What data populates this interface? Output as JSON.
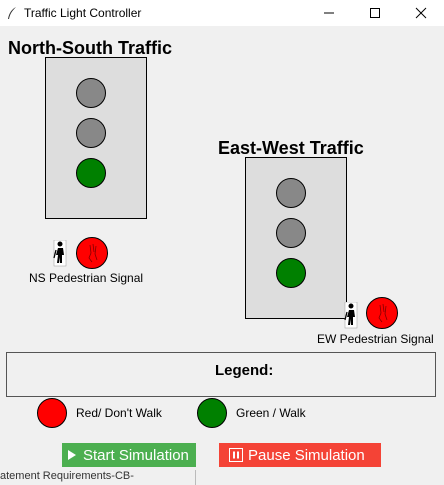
{
  "window": {
    "title": "Traffic Light Controller",
    "icon": "feather-icon",
    "controls": [
      "minimize-icon",
      "maximize-icon",
      "close-icon"
    ]
  },
  "north_south": {
    "heading": "North-South Traffic",
    "lights": [
      {
        "name": "red",
        "color": "#888888"
      },
      {
        "name": "yellow",
        "color": "#888888"
      },
      {
        "name": "green",
        "color": "#008000"
      }
    ],
    "pedestrian": {
      "label": "NS Pedestrian Signal",
      "color": "#ff0000",
      "state": "dont-walk"
    }
  },
  "east_west": {
    "heading": "East-West Traffic",
    "lights": [
      {
        "name": "red",
        "color": "#888888"
      },
      {
        "name": "yellow",
        "color": "#888888"
      },
      {
        "name": "green",
        "color": "#008000"
      }
    ],
    "pedestrian": {
      "label": "EW Pedestrian Signal",
      "color": "#ff0000",
      "state": "dont-walk"
    }
  },
  "legend": {
    "title": "Legend:",
    "items": [
      {
        "label": "Red/ Don't Walk",
        "color": "#ff0000"
      },
      {
        "label": "Green / Walk",
        "color": "#008000"
      }
    ]
  },
  "buttons": {
    "start_label": "Start Simulation",
    "start_color": "#4caf50",
    "pause_label": "Pause Simulation",
    "pause_color": "#f44336"
  },
  "background_window_text": "atement Requirements-CB-"
}
